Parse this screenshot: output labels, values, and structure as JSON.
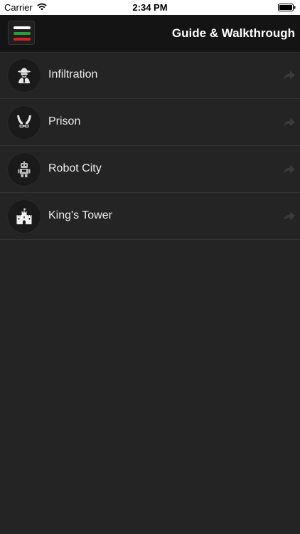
{
  "status_bar": {
    "carrier": "Carrier",
    "time": "2:34 PM",
    "wifi_icon": "wifi-icon",
    "battery_icon": "battery-icon"
  },
  "nav_bar": {
    "title": "Guide & Walkthrough",
    "menu_icon": "hamburger-menu-icon",
    "menu_colors": [
      "#ffffff",
      "#2a9d3a",
      "#d82020"
    ]
  },
  "list": {
    "items": [
      {
        "label": "Infiltration",
        "icon": "spy-icon"
      },
      {
        "label": "Prison",
        "icon": "prison-hands-icon"
      },
      {
        "label": "Robot City",
        "icon": "robot-icon"
      },
      {
        "label": "King's Tower",
        "icon": "castle-icon"
      }
    ]
  },
  "colors": {
    "background": "#242424",
    "nav_background": "#141414",
    "text": "#ececec",
    "arrow": "#3a3a3a"
  }
}
